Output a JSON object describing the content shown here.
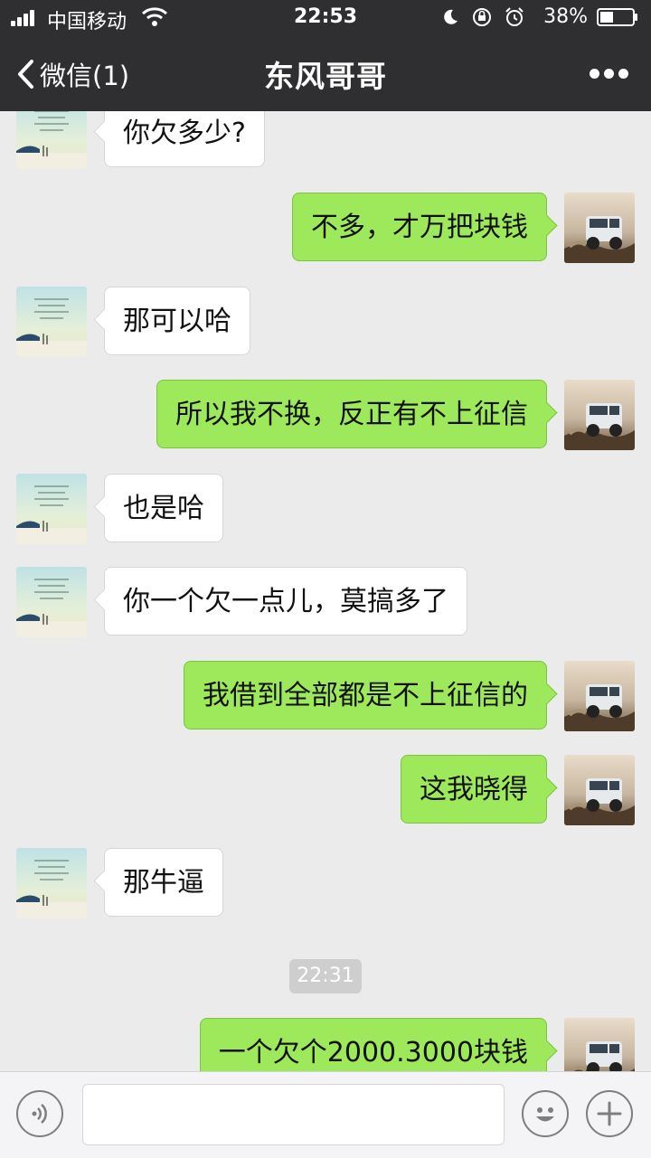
{
  "status_bar": {
    "carrier": "中国移动",
    "time": "22:53",
    "battery_percent": "38%",
    "icons": [
      "signal-icon",
      "wifi-icon",
      "moon-icon",
      "rotation-lock-icon",
      "alarm-icon",
      "battery-icon"
    ]
  },
  "nav": {
    "back_label": "微信(1)",
    "title": "东风哥哥",
    "more_icon": "more-icon"
  },
  "messages": [
    {
      "side": "left",
      "text": "你欠多少?"
    },
    {
      "side": "right",
      "text": "不多，才万把块钱"
    },
    {
      "side": "left",
      "text": "那可以哈"
    },
    {
      "side": "right",
      "text": "所以我不换，反正有不上征信"
    },
    {
      "side": "left",
      "text": "也是哈"
    },
    {
      "side": "left",
      "text": "你一个欠一点儿，莫搞多了"
    },
    {
      "side": "right",
      "text": "我借到全部都是不上征信的"
    },
    {
      "side": "right",
      "text": "这我晓得"
    },
    {
      "side": "left",
      "text": "那牛逼"
    },
    {
      "timestamp": "22:31"
    },
    {
      "side": "right",
      "text": "一个欠个2000.3000块钱"
    }
  ],
  "input_bar": {
    "voice_icon": "voice-icon",
    "emoji_icon": "emoji-icon",
    "plus_icon": "plus-icon",
    "text_value": ""
  },
  "colors": {
    "nav_bg": "#2f2f31",
    "chat_bg": "#ebebeb",
    "sent_bubble": "#9ee85b",
    "received_bubble": "#ffffff"
  }
}
